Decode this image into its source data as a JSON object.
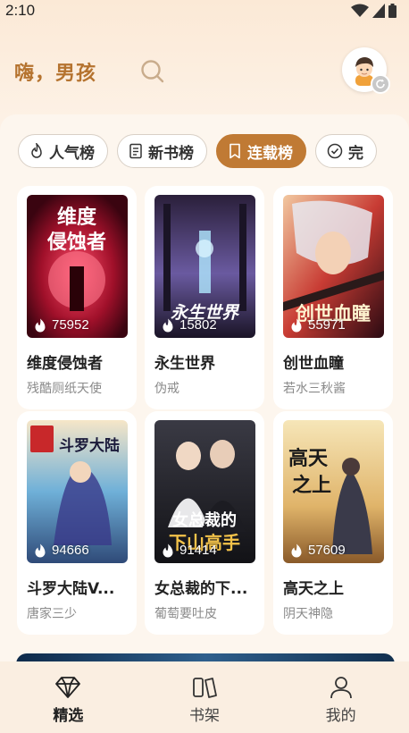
{
  "status_bar": {
    "time": "2:10"
  },
  "header": {
    "greeting": "嗨，男孩"
  },
  "tabs": [
    {
      "label": "人气榜",
      "icon": "flame-outline-icon",
      "active": false
    },
    {
      "label": "新书榜",
      "icon": "book-page-icon",
      "active": false
    },
    {
      "label": "连载榜",
      "icon": "bookmark-icon",
      "active": true
    },
    {
      "label": "完",
      "icon": "check-circle-icon",
      "active": false
    }
  ],
  "books": [
    {
      "title": "维度侵蚀者",
      "author": "残酷厕纸天使",
      "heat": "75952",
      "cover_text": "维度侵蚀者"
    },
    {
      "title": "永生世界",
      "author": "伪戒",
      "heat": "15802",
      "cover_text": "永生世界"
    },
    {
      "title": "创世血瞳",
      "author": "若水三秋酱",
      "heat": "55971",
      "cover_text": "创世血瞳"
    },
    {
      "title": "斗罗大陆V...",
      "author": "唐家三少",
      "heat": "94666",
      "cover_text": "斗罗大陆"
    },
    {
      "title": "女总裁的下...",
      "author": "葡萄要吐皮",
      "heat": "91414",
      "cover_text": "女总裁的下山高手"
    },
    {
      "title": "高天之上",
      "author": "阴天神隐",
      "heat": "57609",
      "cover_text": "高天之上"
    }
  ],
  "bottom_nav": [
    {
      "label": "精选",
      "icon": "diamond-icon",
      "active": true
    },
    {
      "label": "书架",
      "icon": "bookshelf-icon",
      "active": false
    },
    {
      "label": "我的",
      "icon": "person-icon",
      "active": false
    }
  ],
  "colors": {
    "accent": "#c07a34",
    "greeting": "#b5732f",
    "background": "#fdf4ea"
  }
}
